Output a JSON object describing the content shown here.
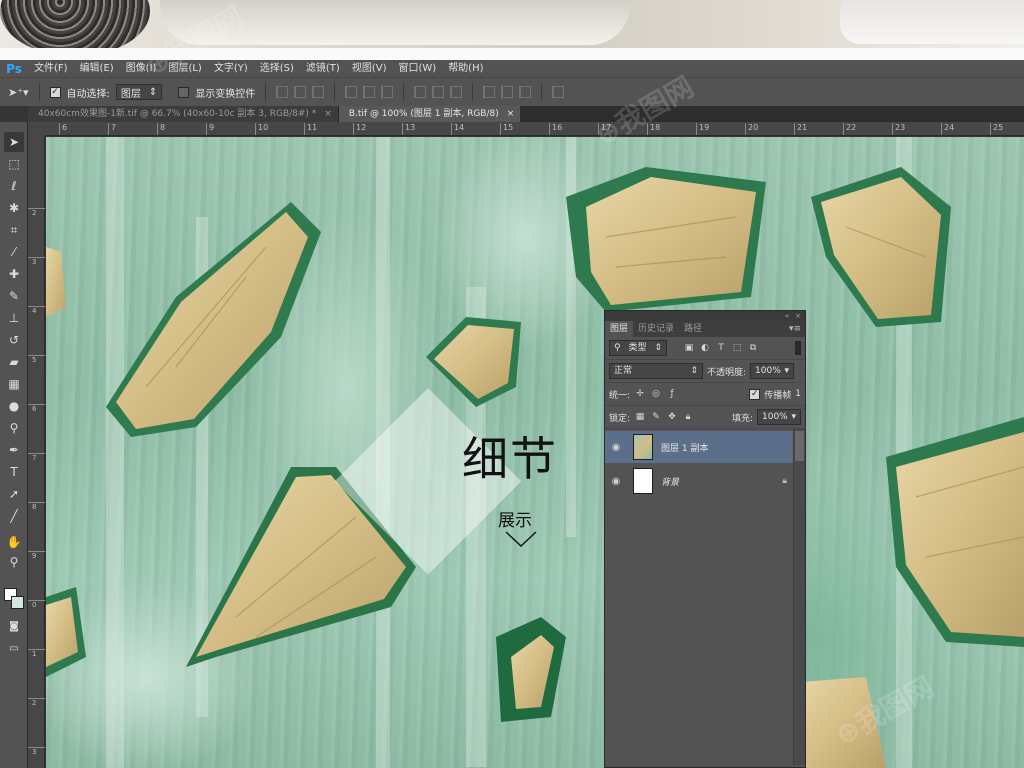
{
  "app": {
    "logo": "Ps",
    "menus": [
      "文件(F)",
      "编辑(E)",
      "图像(I)",
      "图层(L)",
      "文字(Y)",
      "选择(S)",
      "滤镜(T)",
      "视图(V)",
      "窗口(W)",
      "帮助(H)"
    ]
  },
  "options": {
    "auto_select_label": "自动选择:",
    "auto_select_value": "图层",
    "show_transform_label": "显示变换控件"
  },
  "tabs": [
    {
      "label": "40x60cm效果图-1新.tif @ 66.7% (40x60-10c 副本 3, RGB/8#) *",
      "close": "×"
    },
    {
      "label": "B.tif @ 100% (图层 1 副本, RGB/8)",
      "close": "×"
    }
  ],
  "rulers": {
    "horizontal": [
      "6",
      "7",
      "8",
      "9",
      "10",
      "11",
      "12",
      "13",
      "14",
      "15",
      "16",
      "17",
      "18",
      "19",
      "20",
      "21",
      "22",
      "23",
      "24",
      "25"
    ],
    "vertical": [
      "2",
      "3",
      "4",
      "5",
      "6",
      "7",
      "8",
      "9",
      "0",
      "1",
      "2",
      "3",
      "4"
    ]
  },
  "canvas_overlay": {
    "title": "细节",
    "subtitle": "展示"
  },
  "layers_panel": {
    "tabs": [
      "图层",
      "历史记录",
      "路径"
    ],
    "filter_type": "类型",
    "blend_mode": "正常",
    "opacity_label": "不透明度:",
    "opacity_value": "100%",
    "unify_label": "统一:",
    "propagate_label": "传播帧",
    "propagate_value": "1",
    "lock_label": "锁定:",
    "fill_label": "填充:",
    "fill_value": "100%",
    "layers": [
      {
        "name": "图层 1 副本",
        "selected": true
      },
      {
        "name": "背景",
        "locked": true
      }
    ]
  },
  "colors": {
    "chrome": "#535353",
    "selected_layer": "#5c6f8a",
    "ps_blue": "#31a8ff"
  }
}
